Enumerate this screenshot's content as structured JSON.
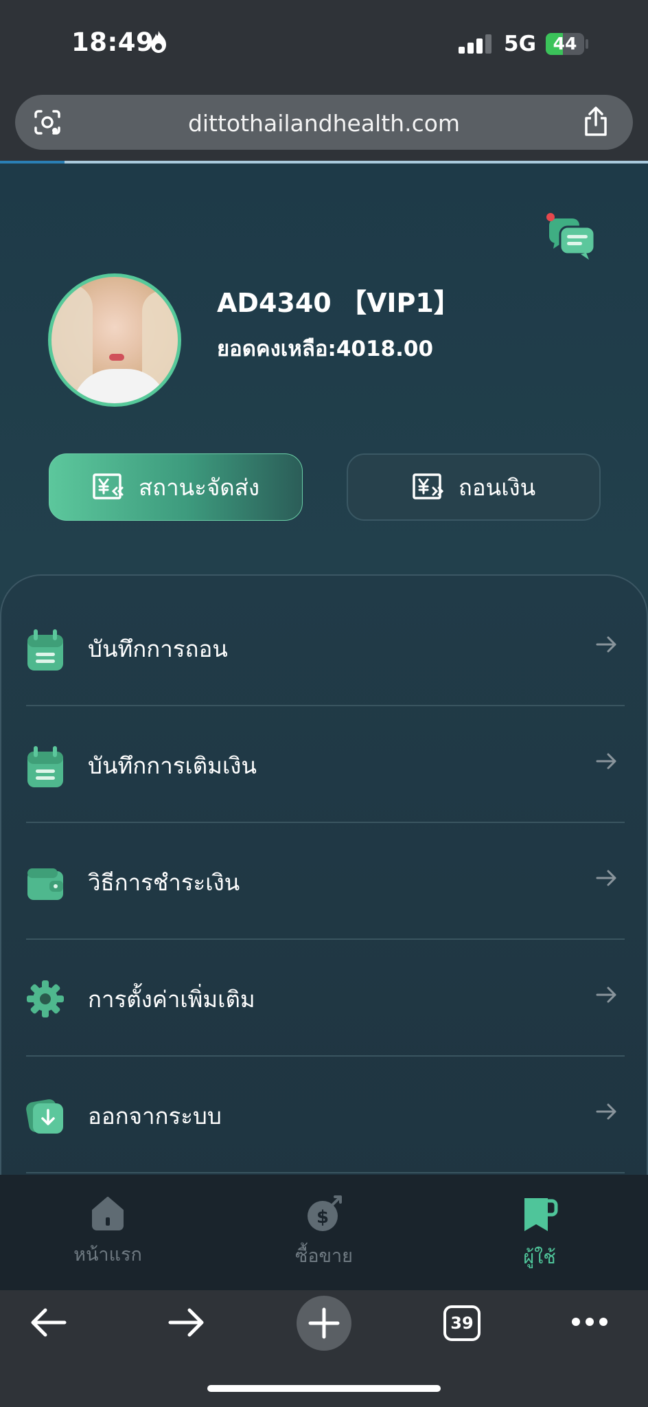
{
  "status_bar": {
    "time": "18:49",
    "network": "5G",
    "battery": "44",
    "battery_level": 0.44
  },
  "browser": {
    "url": "dittothailandhealth.com",
    "tabs_count": "39"
  },
  "profile": {
    "name": "AD4340 【VIP1】",
    "balance": "ยอดคงเหลือ:4018.00"
  },
  "actions": {
    "shipping_status": "สถานะจัดส่ง",
    "withdraw": "ถอนเงิน"
  },
  "menu": [
    {
      "label": "บันทึกการถอน",
      "icon": "calendar-icon"
    },
    {
      "label": "บันทึกการเติมเงิน",
      "icon": "calendar-icon"
    },
    {
      "label": "วิธีการชำระเงิน",
      "icon": "wallet-icon"
    },
    {
      "label": "การตั้งค่าเพิ่มเติม",
      "icon": "gear-icon"
    },
    {
      "label": "ออกจากระบบ",
      "icon": "logout-icon"
    }
  ],
  "tabbar": [
    {
      "label": "หน้าแรก",
      "icon": "home-icon",
      "active": false
    },
    {
      "label": "ซื้อขาย",
      "icon": "dollar-trade-icon",
      "active": false
    },
    {
      "label": "ผู้ใช้",
      "icon": "user-bookmark-icon",
      "active": true
    }
  ],
  "colors": {
    "accent": "#4fc59a",
    "background": "#1e3a48",
    "chrome": "#2f3338"
  }
}
